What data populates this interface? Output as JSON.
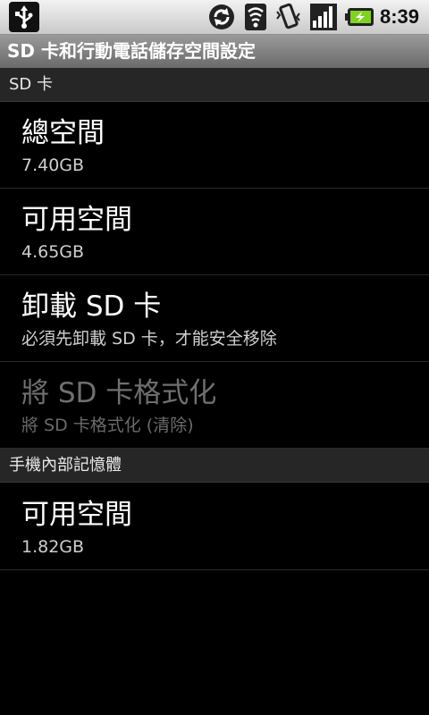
{
  "status_bar": {
    "time": "8:39",
    "icons": [
      "usb-debug-icon",
      "sync-icon",
      "wifi-icon",
      "vibrate-icon",
      "signal-icon",
      "battery-charging-icon"
    ]
  },
  "title_bar": {
    "title": "SD 卡和行動電話儲存空間設定"
  },
  "sections": [
    {
      "header": "SD 卡",
      "items": [
        {
          "title": "總空間",
          "summary": "7.40GB",
          "enabled": true
        },
        {
          "title": "可用空間",
          "summary": "4.65GB",
          "enabled": true
        },
        {
          "title": "卸載 SD 卡",
          "summary": "必須先卸載 SD 卡，才能安全移除",
          "enabled": true
        },
        {
          "title": "將 SD 卡格式化",
          "summary": "將 SD 卡格式化 (清除)",
          "enabled": false
        }
      ]
    },
    {
      "header": "手機內部記憶體",
      "items": [
        {
          "title": "可用空間",
          "summary": "1.82GB",
          "enabled": true
        }
      ]
    }
  ],
  "colors": {
    "background": "#000000",
    "title_bar": "#7a7a7a",
    "section_header": "#262626",
    "disabled_text": "#6f6f6f"
  }
}
